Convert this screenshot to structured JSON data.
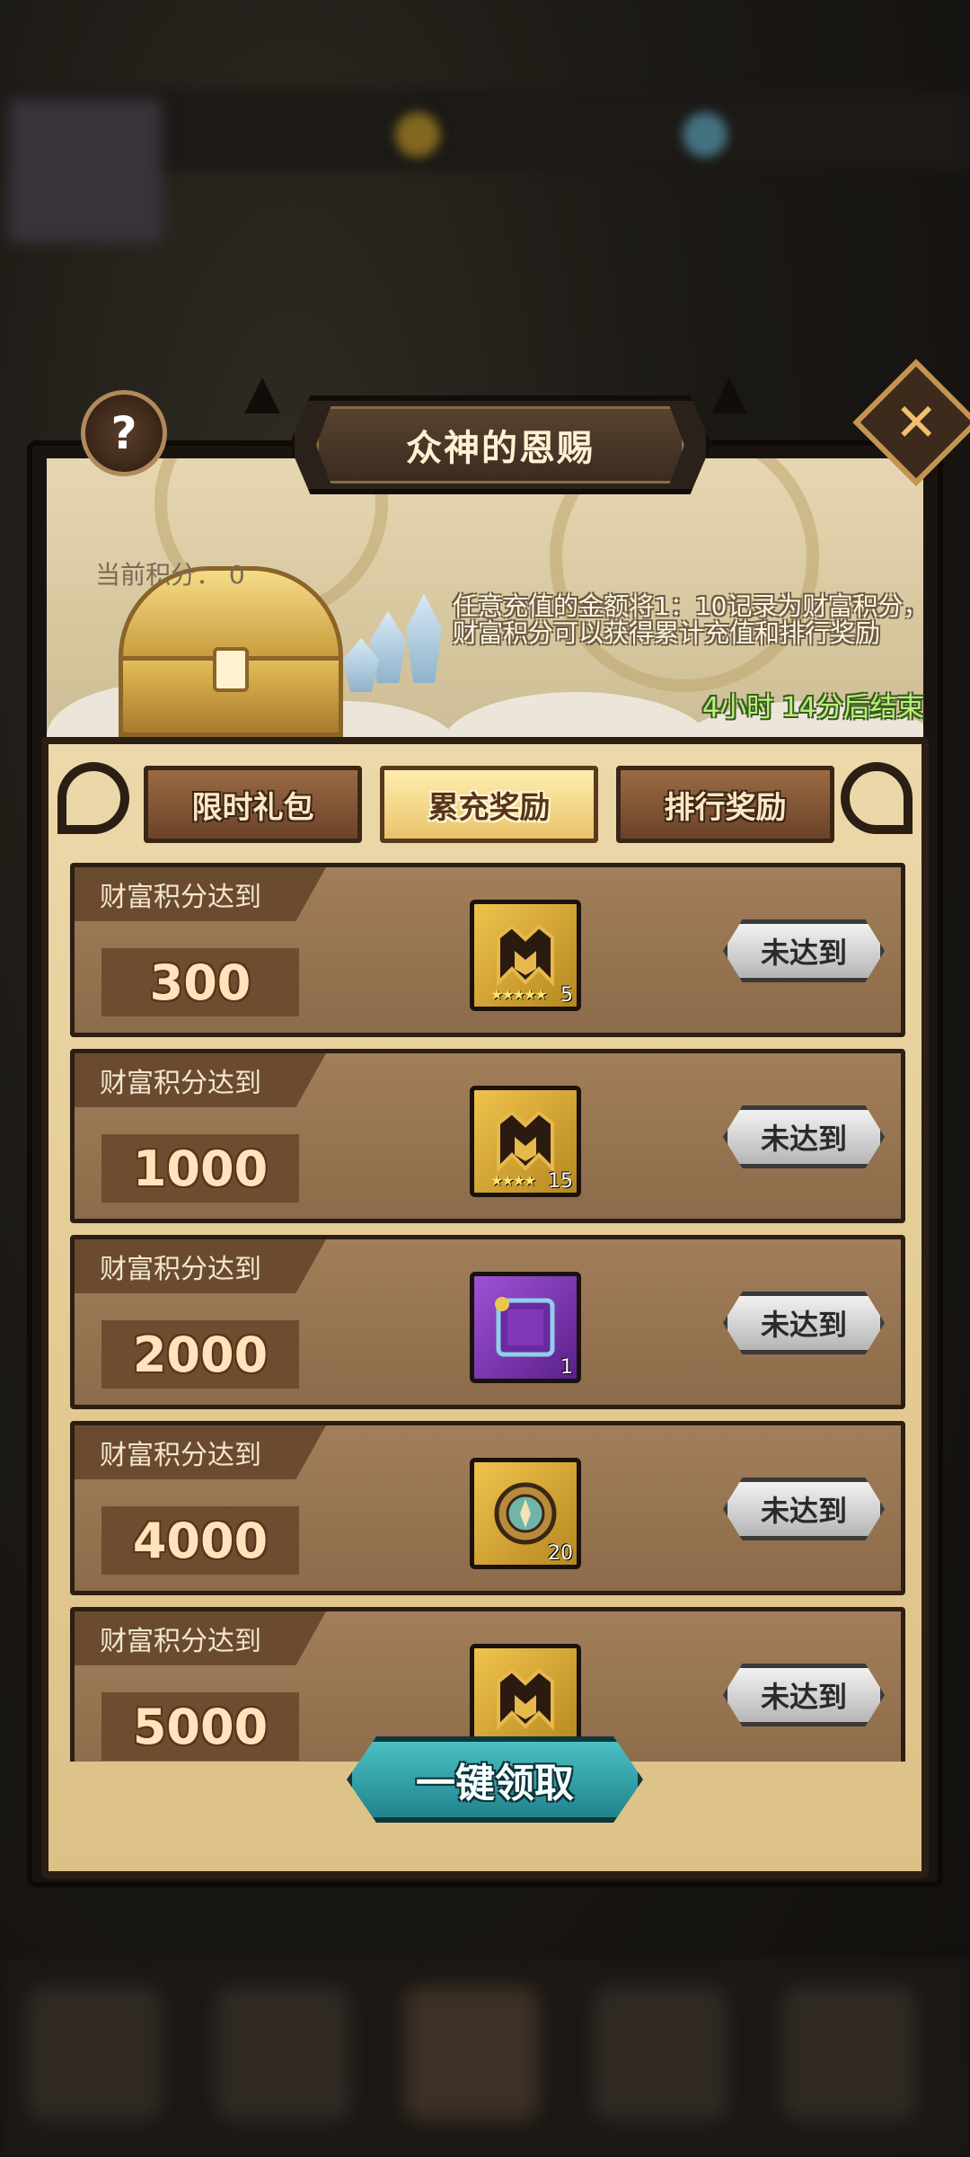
{
  "dialog": {
    "title": "众神的恩赐",
    "help_label": "?",
    "close_label": "✕",
    "current_score_label": "当前积分：",
    "current_score_value": "0",
    "description": "任意充值的金额将1：10记录为财富积分，财富积分可以获得累计充值和排行奖励",
    "countdown": "4小时 14分后结束"
  },
  "tabs": [
    {
      "label": "限时礼包",
      "active": false
    },
    {
      "label": "累充奖励",
      "active": true
    },
    {
      "label": "排行奖励",
      "active": false
    }
  ],
  "rewards": [
    {
      "label": "财富积分达到",
      "threshold": "300",
      "item_icon": "helmet-icon",
      "item_stars": "★★★★★",
      "item_count": "5",
      "item_color": "gold",
      "status": "未达到"
    },
    {
      "label": "财富积分达到",
      "threshold": "1000",
      "item_icon": "helmet-icon",
      "item_stars": "★★★★",
      "item_count": "15",
      "item_color": "gold",
      "status": "未达到"
    },
    {
      "label": "财富积分达到",
      "threshold": "2000",
      "item_icon": "frame-icon",
      "item_stars": "",
      "item_count": "1",
      "item_color": "purple",
      "status": "未达到"
    },
    {
      "label": "财富积分达到",
      "threshold": "4000",
      "item_icon": "compass-icon",
      "item_stars": "",
      "item_count": "20",
      "item_color": "gold",
      "status": "未达到"
    },
    {
      "label": "财富积分达到",
      "threshold": "5000",
      "item_icon": "helmet-icon",
      "item_stars": "",
      "item_count": "",
      "item_color": "gold",
      "status": "未达到"
    }
  ],
  "claim_all_label": "一键领取",
  "colors": {
    "accent_teal": "#21838d",
    "tab_active": "#e9c46a",
    "countdown_green": "#b8f07a"
  }
}
